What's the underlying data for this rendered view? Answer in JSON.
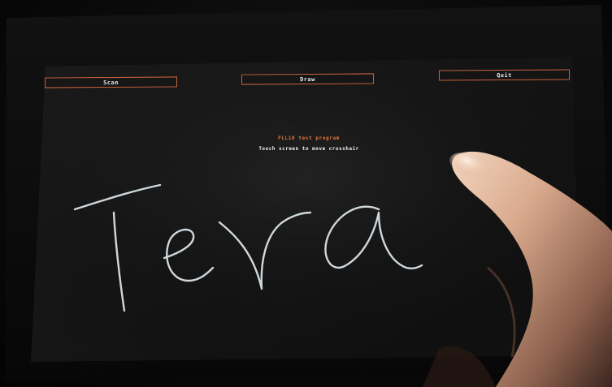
{
  "buttons": {
    "scan_label": "Scan",
    "draw_label": "Draw",
    "quit_label": "Quit"
  },
  "program": {
    "title": "FLL10 test program",
    "instruction": "Touch screen to move crosshair"
  },
  "handwriting": {
    "text": "Tera",
    "stroke_color": "#dfe9ee"
  },
  "colors": {
    "button_border": "#c8613e",
    "title_color": "#e07a3a",
    "screen_background": "#161616"
  }
}
